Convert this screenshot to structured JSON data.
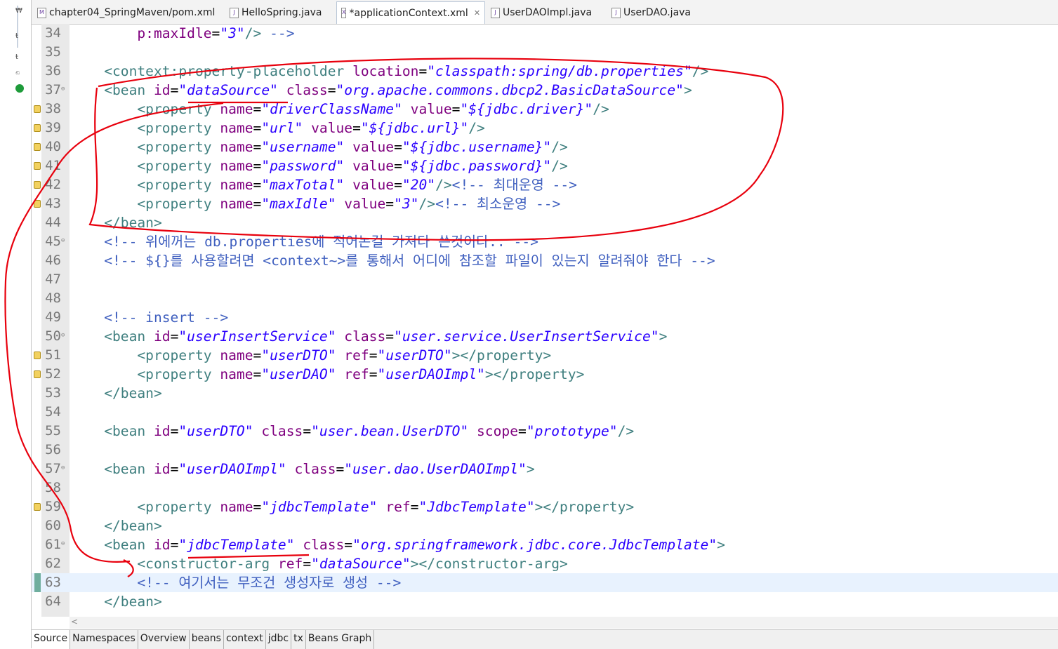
{
  "tabs": [
    {
      "label": "chapter04_SpringMaven/pom.xml",
      "icon": "M",
      "active": false
    },
    {
      "label": "HelloSpring.java",
      "icon": "J",
      "active": false
    },
    {
      "label": "*applicationContext.xml",
      "icon": "X",
      "active": true
    },
    {
      "label": "UserDAOImpl.java",
      "icon": "J",
      "active": false
    },
    {
      "label": "UserDAO.java",
      "icon": "J",
      "active": false
    }
  ],
  "close_glyph": "✕",
  "lines": [
    {
      "n": "34",
      "text": "        p:maxIdle=\"3\"/> -->"
    },
    {
      "n": "35",
      "text": ""
    },
    {
      "n": "36",
      "text": "    <context:property-placeholder location=\"classpath:spring/db.properties\"/>"
    },
    {
      "n": "37",
      "text": "    <bean id=\"dataSource\" class=\"org.apache.commons.dbcp2.BasicDataSource\">"
    },
    {
      "n": "38",
      "text": "        <property name=\"driverClassName\" value=\"${jdbc.driver}\"/>"
    },
    {
      "n": "39",
      "text": "        <property name=\"url\" value=\"${jdbc.url}\"/>"
    },
    {
      "n": "40",
      "text": "        <property name=\"username\" value=\"${jdbc.username}\"/>"
    },
    {
      "n": "41",
      "text": "        <property name=\"password\" value=\"${jdbc.password}\"/>"
    },
    {
      "n": "42",
      "text": "        <property name=\"maxTotal\" value=\"20\"/><!-- 최대운영 -->"
    },
    {
      "n": "43",
      "text": "        <property name=\"maxIdle\" value=\"3\"/><!-- 최소운영 -->"
    },
    {
      "n": "44",
      "text": "    </bean>"
    },
    {
      "n": "45",
      "text": "    <!-- 위에꺼는 db.properties에 적어논걸 가져다 쓴것이다.. -->"
    },
    {
      "n": "46",
      "text": "    <!-- ${}를 사용할려면 <context~>를 통해서 어디에 참조할 파일이 있는지 알려줘야 한다 -->"
    },
    {
      "n": "47",
      "text": ""
    },
    {
      "n": "48",
      "text": ""
    },
    {
      "n": "49",
      "text": "    <!-- insert -->"
    },
    {
      "n": "50",
      "text": "    <bean id=\"userInsertService\" class=\"user.service.UserInsertService\">"
    },
    {
      "n": "51",
      "text": "        <property name=\"userDTO\" ref=\"userDTO\"></property>"
    },
    {
      "n": "52",
      "text": "        <property name=\"userDAO\" ref=\"userDAOImpl\"></property>"
    },
    {
      "n": "53",
      "text": "    </bean>"
    },
    {
      "n": "54",
      "text": ""
    },
    {
      "n": "55",
      "text": "    <bean id=\"userDTO\" class=\"user.bean.UserDTO\" scope=\"prototype\"/>"
    },
    {
      "n": "56",
      "text": ""
    },
    {
      "n": "57",
      "text": "    <bean id=\"userDAOImpl\" class=\"user.dao.UserDAOImpl\">"
    },
    {
      "n": "58",
      "text": ""
    },
    {
      "n": "59",
      "text": "        <property name=\"jdbcTemplate\" ref=\"JdbcTemplate\"></property>"
    },
    {
      "n": "60",
      "text": "    </bean>"
    },
    {
      "n": "61",
      "text": "    <bean id=\"jdbcTemplate\" class=\"org.springframework.jdbc.core.JdbcTemplate\">"
    },
    {
      "n": "62",
      "text": "        <constructor-arg ref=\"dataSource\"></constructor-arg>"
    },
    {
      "n": "63",
      "text": "        <!-- 여기서는 무조건 생성자로 생성 -->"
    },
    {
      "n": "64",
      "text": "    </bean>"
    }
  ],
  "bottom_tabs": [
    "Source",
    "Namespaces",
    "Overview",
    "beans",
    "context",
    "jdbc",
    "tx",
    "Beans Graph"
  ],
  "hscroll_arrow": "<",
  "colors": {
    "tag": "#3f7f7f",
    "attr": "#7f007f",
    "value": "#2a00ff",
    "comment": "#3f5fbf",
    "annotation": "#e8000d",
    "current_line": "#e8f2fe"
  }
}
